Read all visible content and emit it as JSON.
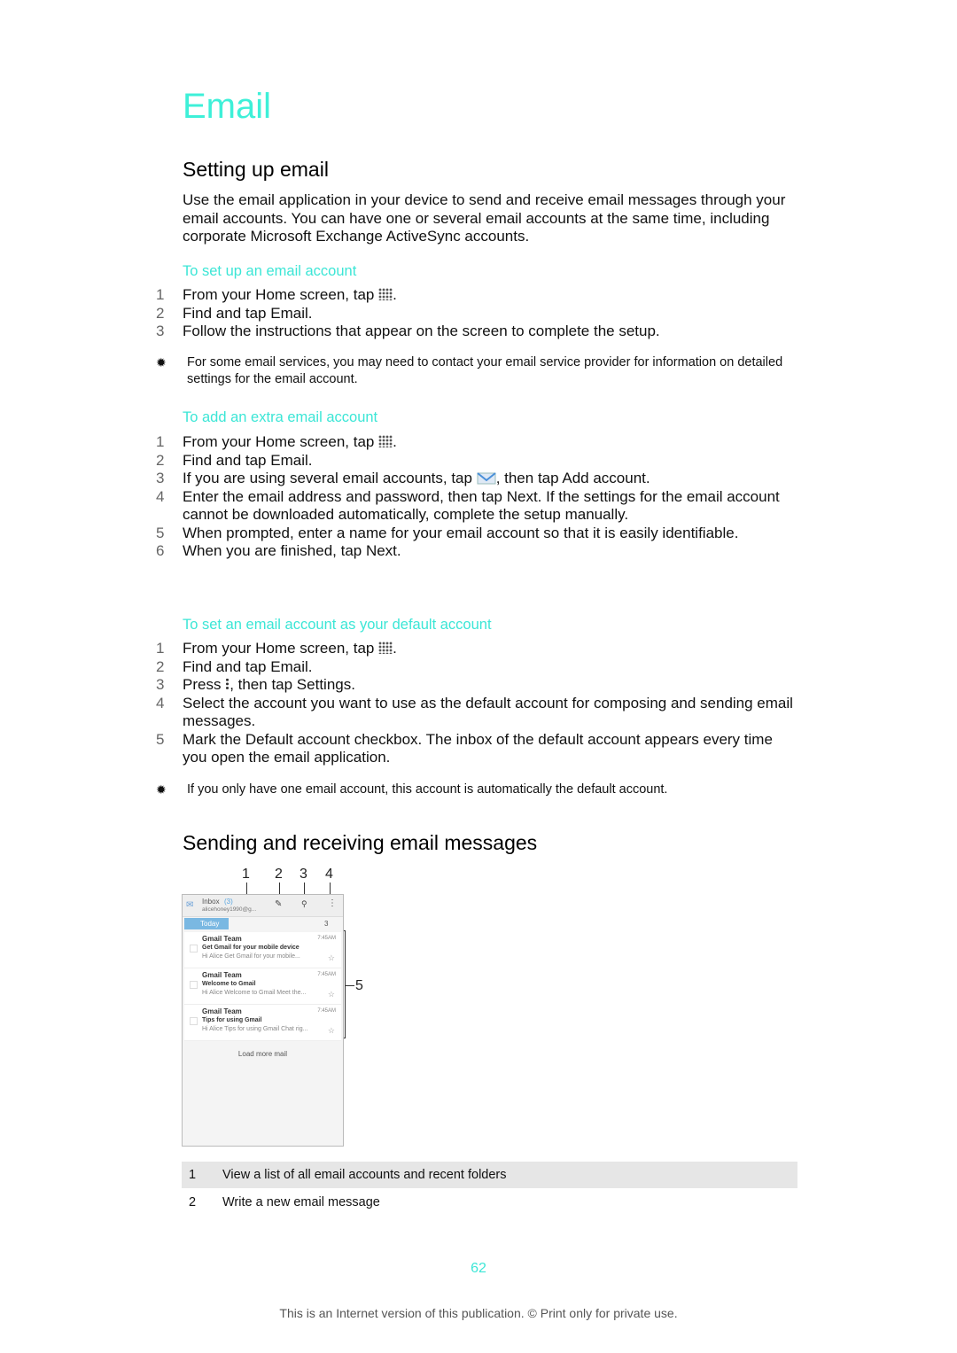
{
  "title": "Email",
  "sections": {
    "setting_up": {
      "heading": "Setting up email",
      "intro": "Use the email application in your device to send and receive email messages through your email accounts. You can have one or several email accounts at the same time, including corporate Microsoft Exchange ActiveSync accounts.",
      "proc1": {
        "heading": "To set up an email account",
        "steps": [
          {
            "n": "1",
            "pre": "From your Home screen, tap ",
            "icon": "apps-grid-icon",
            "post": "."
          },
          {
            "n": "2",
            "text": "Find and tap Email."
          },
          {
            "n": "3",
            "text": "Follow the instructions that appear on the screen to complete the setup."
          }
        ],
        "tip": "For some email services, you may need to contact your email service provider for information on detailed settings for the email account."
      },
      "proc2": {
        "heading": "To add an extra email account",
        "steps": [
          {
            "n": "1",
            "pre": "From your Home screen, tap ",
            "icon": "apps-grid-icon",
            "post": "."
          },
          {
            "n": "2",
            "text": "Find and tap Email."
          },
          {
            "n": "3",
            "pre": "If you are using several email accounts, tap ",
            "icon": "envelope-icon",
            "post": ", then tap Add account."
          },
          {
            "n": "4",
            "text": "Enter the email address and password, then tap Next. If the settings for the email account cannot be downloaded automatically, complete the setup manually."
          },
          {
            "n": "5",
            "text": "When prompted, enter a name for your email account so that it is easily identifiable."
          },
          {
            "n": "6",
            "text": "When you are finished, tap Next."
          }
        ]
      },
      "proc3": {
        "heading": "To set an email account as your default account",
        "steps": [
          {
            "n": "1",
            "pre": "From your Home screen, tap ",
            "icon": "apps-grid-icon",
            "post": "."
          },
          {
            "n": "2",
            "text": "Find and tap Email."
          },
          {
            "n": "3",
            "pre": "Press ",
            "icon": "menu-icon",
            "post": ", then tap Settings."
          },
          {
            "n": "4",
            "text": "Select the account you want to use as the default account for composing and sending email messages."
          },
          {
            "n": "5",
            "text": "Mark the Default account checkbox. The inbox of the default account appears every time you open the email application."
          }
        ],
        "tip": "If you only have one email account, this account is automatically the default account."
      }
    },
    "sending": {
      "heading": "Sending and receiving email messages",
      "callouts": [
        "1",
        "2",
        "3",
        "4",
        "5"
      ],
      "screenshot": {
        "inbox_label": "Inbox",
        "inbox_count": "(3)",
        "account": "alicehoney1990@g...",
        "today_label": "Today",
        "today_count": "3",
        "mails": [
          {
            "from": "Gmail Team",
            "subject": "Get Gmail for your mobile device",
            "preview": "Hi Alice Get Gmail for your mobile...",
            "time": "7:45AM"
          },
          {
            "from": "Gmail Team",
            "subject": "Welcome to Gmail",
            "preview": "Hi Alice Welcome to Gmail Meet the...",
            "time": "7:45AM"
          },
          {
            "from": "Gmail Team",
            "subject": "Tips for using Gmail",
            "preview": "Hi Alice Tips for using Gmail Chat rig...",
            "time": "7:45AM"
          }
        ],
        "load_more": "Load more mail"
      },
      "legend": [
        {
          "n": "1",
          "text": "View a list of all email accounts and recent folders"
        },
        {
          "n": "2",
          "text": "Write a new email message"
        }
      ]
    }
  },
  "footer": {
    "page_number": "62",
    "notice": "This is an Internet version of this publication. © Print only for private use."
  }
}
